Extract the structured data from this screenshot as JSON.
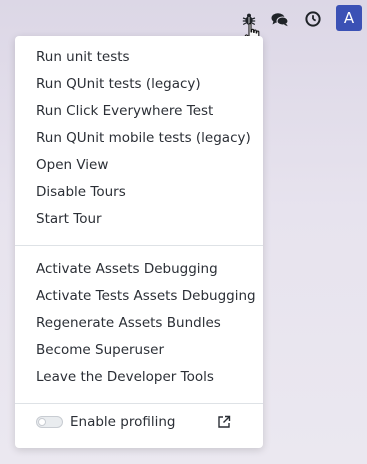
{
  "systray": {
    "icons": [
      {
        "name": "bug-icon"
      },
      {
        "name": "chat-icon"
      },
      {
        "name": "clock-icon"
      }
    ],
    "avatar_letter": "A",
    "avatar_color": "#3b51b5"
  },
  "debug_menu": {
    "group_tests": [
      "Run unit tests",
      "Run QUnit tests (legacy)",
      "Run Click Everywhere Test",
      "Run QUnit mobile tests (legacy)",
      "Open View",
      "Disable Tours",
      "Start Tour"
    ],
    "group_assets": [
      "Activate Assets Debugging",
      "Activate Tests Assets Debugging",
      "Regenerate Assets Bundles",
      "Become Superuser",
      "Leave the Developer Tools"
    ],
    "profiling": {
      "label": "Enable profiling",
      "enabled": false,
      "link_icon": "external-link-icon"
    }
  }
}
